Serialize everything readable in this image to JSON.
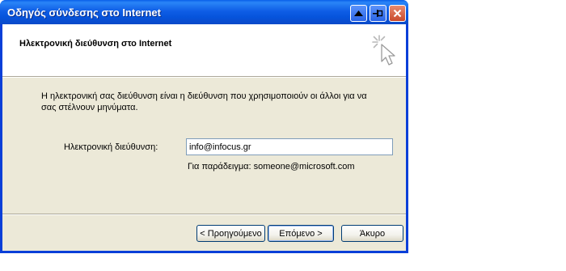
{
  "window": {
    "title": "Οδηγός σύνδεσης στο Internet",
    "controls": [
      "up-arrow-icon",
      "pin-icon",
      "close-icon"
    ]
  },
  "header": {
    "title": "Ηλεκτρονική διεύθυνση στο Internet",
    "icon": "wizard-cursor-icon"
  },
  "body": {
    "description": "Η ηλεκτρονική σας διεύθυνση είναι η διεύθυνση που χρησιμοποιούν οι άλλοι για να σας στέλνουν μηνύματα.",
    "email_label": "Ηλεκτρονική διεύθυνση:",
    "email_value": "info@infocus.gr",
    "example": "Για παράδειγμα: someone@microsoft.com"
  },
  "buttons": {
    "back": "< Προηγούμενο",
    "next": "Επόμενο >",
    "cancel": "Άκυρο"
  },
  "colors": {
    "titlebar": "#0a5fe8",
    "dialog_bg": "#ece9d8",
    "close_button": "#c94a2c"
  }
}
